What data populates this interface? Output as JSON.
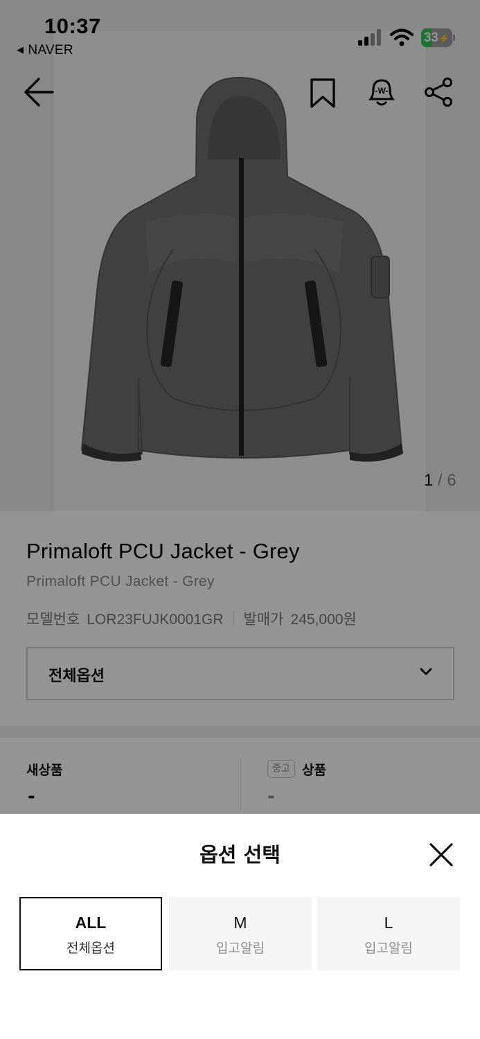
{
  "status_bar": {
    "time": "10:37",
    "back_app": "NAVER",
    "battery": "33",
    "battery_level_percent": 33,
    "charging": true
  },
  "gallery": {
    "current_page": "1",
    "total_pages": "6",
    "separator": "/",
    "icons": [
      "back-arrow-icon",
      "bookmark-icon",
      "alarm-bell-icon",
      "share-icon"
    ]
  },
  "product": {
    "title": "Primaloft PCU Jacket - Grey",
    "subtitle": "Primaloft PCU Jacket - Grey",
    "model_label": "모델번호",
    "model_value": "LOR23FUJK0001GR",
    "release_label": "발매가",
    "release_value": "245,000원",
    "option_dropdown": "전체옵션"
  },
  "prices": {
    "new_label": "새상품",
    "new_value": "-",
    "used_badge": "중고",
    "used_label": "상품",
    "used_value": "-"
  },
  "sheet": {
    "title": "옵션 선택",
    "options": [
      {
        "main": "ALL",
        "sub": "전체옵션",
        "selected": true
      },
      {
        "main": "M",
        "sub": "입고알림",
        "selected": false
      },
      {
        "main": "L",
        "sub": "입고알림",
        "selected": false
      }
    ]
  },
  "colors": {
    "accent": "#111111",
    "battery_green": "#34c759",
    "muted_text": "#8a8a8a"
  }
}
